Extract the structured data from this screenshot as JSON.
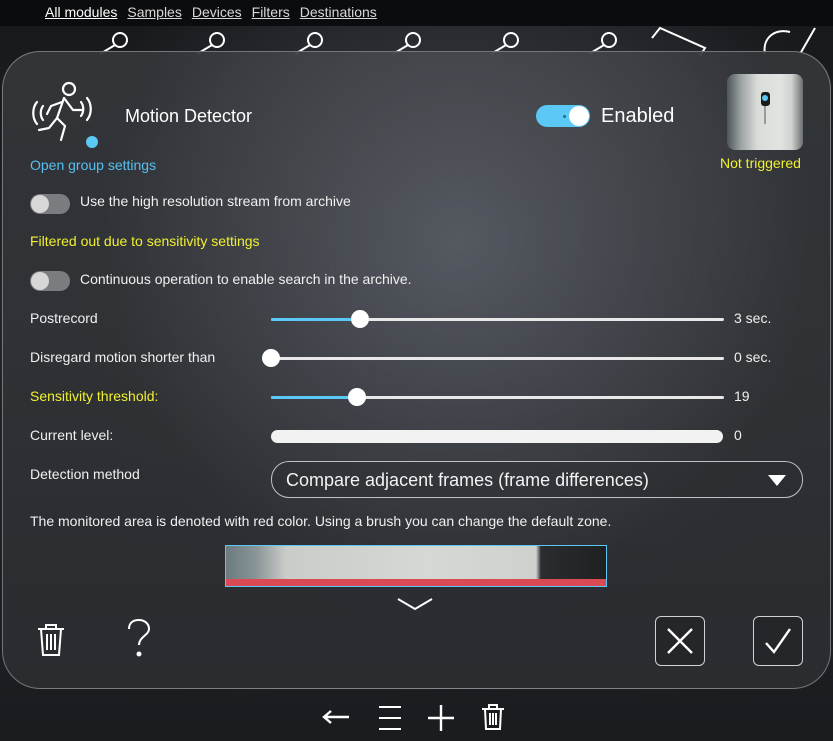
{
  "topnav": {
    "items": [
      "All modules",
      "Samples",
      "Devices",
      "Filters",
      "Destinations"
    ]
  },
  "module": {
    "title": "Motion Detector",
    "enabled_label": "Enabled",
    "enabled": true,
    "status": "Not triggered",
    "open_group_settings": "Open group settings"
  },
  "settings": {
    "high_res_label": "Use the high resolution stream from archive",
    "high_res_on": false,
    "filtered_note": "Filtered out due to sensitivity settings",
    "continuous_label": "Continuous operation to enable search in the archive.",
    "continuous_on": false,
    "postrecord": {
      "label": "Postrecord",
      "value_text": "3 sec.",
      "fraction": 0.2
    },
    "disregard": {
      "label": "Disregard motion shorter than",
      "value_text": "0 sec.",
      "fraction": 0.0
    },
    "sensitivity": {
      "label": "Sensitivity threshold:",
      "value_text": "19",
      "fraction": 0.19
    },
    "current_level": {
      "label": "Current level:",
      "value_text": "0",
      "fraction": 1.0
    },
    "detection_method": {
      "label": "Detection method",
      "selected": "Compare adjacent frames (frame differences)"
    },
    "zone_note": "The monitored area is denoted with red color. Using a brush you can change the default zone."
  },
  "icons": {
    "motion": "running-person-icon",
    "expand": "chevron-down-icon",
    "delete": "trash-icon",
    "help": "question-mark-icon",
    "cancel": "close-icon",
    "confirm": "checkmark-icon",
    "back": "arrow-left-icon",
    "menu": "hamburger-icon",
    "add": "plus-icon"
  },
  "colors": {
    "accent": "#5bc8f5",
    "highlight": "#f0f030",
    "zone": "#d94a55"
  }
}
